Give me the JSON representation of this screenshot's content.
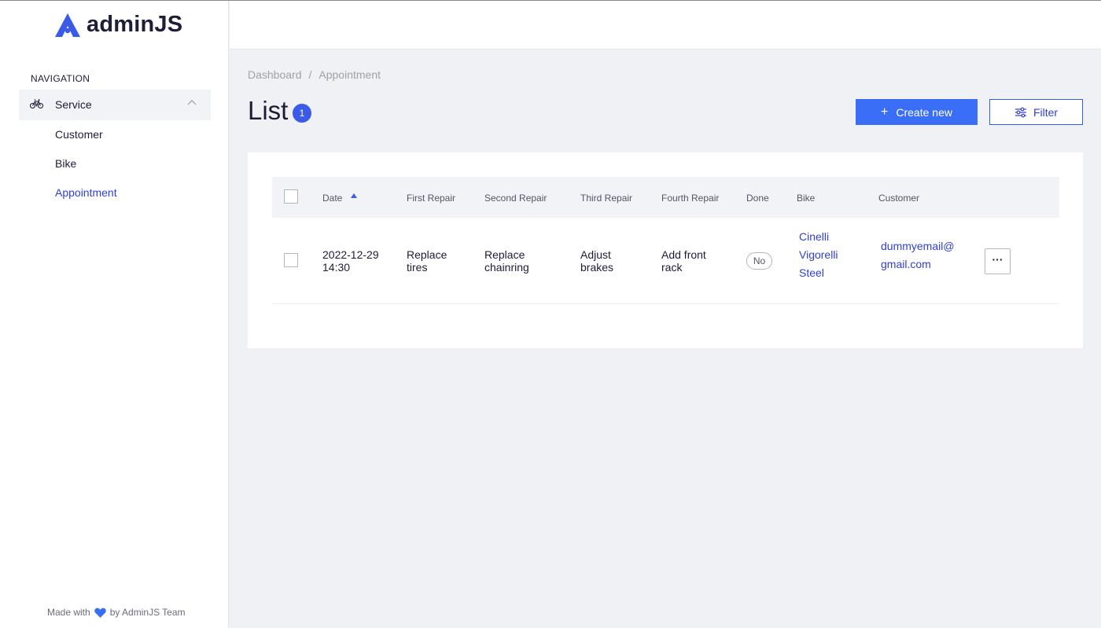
{
  "brand": {
    "name": "adminJS",
    "color": "#3a5ae8"
  },
  "sidebar": {
    "nav_title": "NAVIGATION",
    "group": {
      "label": "Service",
      "icon": "bike-icon",
      "expanded": true
    },
    "items": [
      {
        "label": "Customer",
        "active": false
      },
      {
        "label": "Bike",
        "active": false
      },
      {
        "label": "Appointment",
        "active": true
      }
    ],
    "footer": {
      "prefix": "Made with",
      "suffix": "by AdminJS Team",
      "icon": "heart-icon"
    }
  },
  "breadcrumb": {
    "items": [
      "Dashboard",
      "Appointment"
    ],
    "separator": "/"
  },
  "page": {
    "title": "List",
    "count": "1"
  },
  "actions": {
    "create_label": "Create new",
    "create_icon": "plus-icon",
    "filter_label": "Filter",
    "filter_icon": "sliders-icon"
  },
  "table": {
    "columns": [
      "Date",
      "First Repair",
      "Second Repair",
      "Third Repair",
      "Fourth Repair",
      "Done",
      "Bike",
      "Customer"
    ],
    "sort": {
      "column": "Date",
      "direction": "asc"
    },
    "rows": [
      {
        "date": [
          "2022-12-29",
          "14:30"
        ],
        "first_repair": [
          "Replace",
          "tires"
        ],
        "second_repair": [
          "Replace",
          "chainring"
        ],
        "third_repair": [
          "Adjust",
          "brakes"
        ],
        "fourth_repair": [
          "Add front",
          "rack"
        ],
        "done": "No",
        "bike": [
          "Cinelli",
          "Vigorelli",
          "Steel"
        ],
        "customer": [
          "dummyemail@",
          "gmail.com"
        ],
        "actions_label": "···"
      }
    ]
  },
  "colors": {
    "primary": "#3b6ef6",
    "link": "#3040d6",
    "background": "#f0f1f4"
  }
}
